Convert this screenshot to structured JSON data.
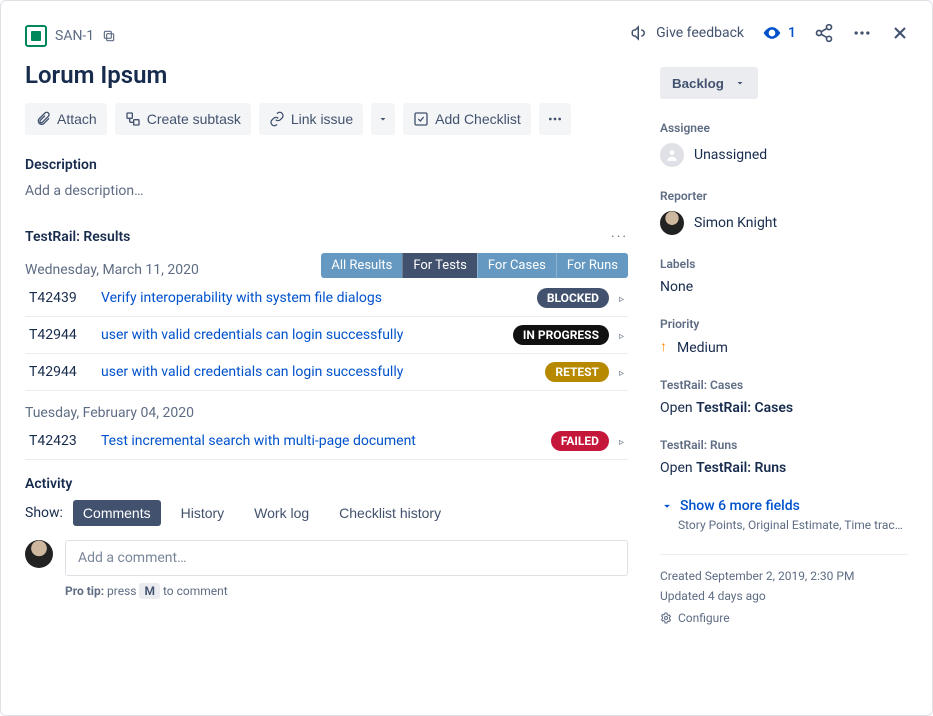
{
  "breadcrumb": {
    "key": "SAN-1"
  },
  "title": "Lorum Ipsum",
  "toolbar": {
    "attach": "Attach",
    "subtask": "Create subtask",
    "link": "Link issue",
    "checklist": "Add Checklist"
  },
  "description": {
    "label": "Description",
    "placeholder": "Add a description…"
  },
  "testrail": {
    "title": "TestRail: Results",
    "tabs": {
      "all": "All Results",
      "tests": "For Tests",
      "cases": "For Cases",
      "runs": "For Runs"
    },
    "groups": [
      {
        "date": "Wednesday, March 11, 2020",
        "rows": [
          {
            "id": "T42439",
            "name": "Verify interoperability with system file dialogs",
            "status": "BLOCKED",
            "cls": "blocked"
          },
          {
            "id": "T42944",
            "name": "user with valid credentials can login successfully",
            "status": "IN PROGRESS",
            "cls": "inprog"
          },
          {
            "id": "T42944",
            "name": "user with valid credentials can login successfully",
            "status": "RETEST",
            "cls": "retest"
          }
        ]
      },
      {
        "date": "Tuesday, February 04, 2020",
        "rows": [
          {
            "id": "T42423",
            "name": "Test incremental search with multi-page document",
            "status": "FAILED",
            "cls": "failed"
          }
        ]
      }
    ]
  },
  "activity": {
    "title": "Activity",
    "show": "Show:",
    "tabs": {
      "comments": "Comments",
      "history": "History",
      "worklog": "Work log",
      "checklist": "Checklist history"
    },
    "comment_placeholder": "Add a comment…",
    "protip_prefix": "Pro tip:",
    "protip_press": " press ",
    "protip_key": "M",
    "protip_suffix": " to comment"
  },
  "top": {
    "feedback": "Give feedback",
    "watchers": "1"
  },
  "side": {
    "status": "Backlog",
    "assignee_label": "Assignee",
    "assignee_value": "Unassigned",
    "reporter_label": "Reporter",
    "reporter_value": "Simon Knight",
    "labels_label": "Labels",
    "labels_value": "None",
    "priority_label": "Priority",
    "priority_value": "Medium",
    "cases_label": "TestRail: Cases",
    "cases_open": "Open ",
    "cases_bold": "TestRail: Cases",
    "runs_label": "TestRail: Runs",
    "runs_open": "Open ",
    "runs_bold": "TestRail: Runs",
    "showmore": "Show 6 more fields",
    "moretxt": "Story Points, Original Estimate, Time tracking…",
    "created": "Created September 2, 2019, 2:30 PM",
    "updated": "Updated 4 days ago",
    "configure": "Configure"
  }
}
